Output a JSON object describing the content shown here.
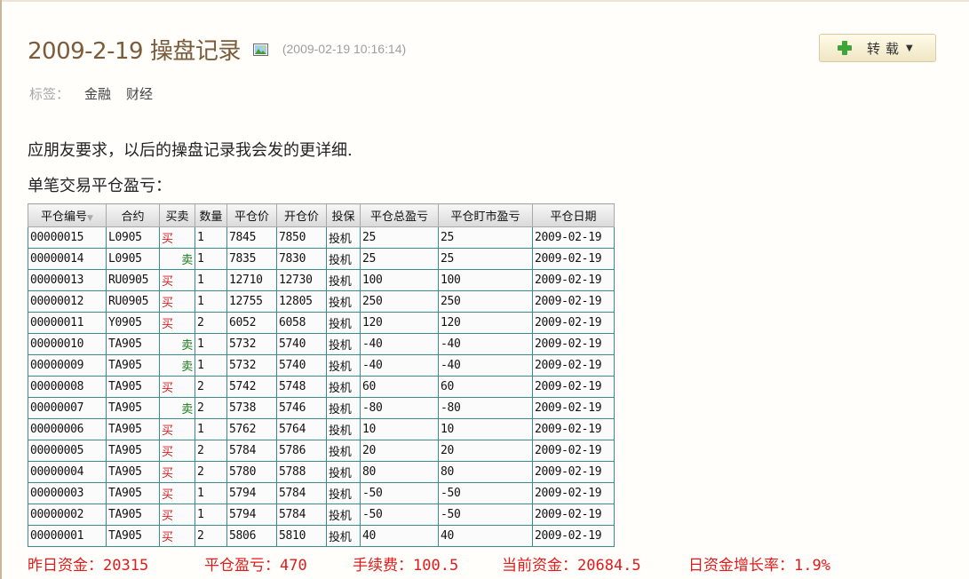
{
  "post": {
    "title": "2009-2-19 操盘记录",
    "time": "(2009-02-19 10:16:14)",
    "repost_label": "转载",
    "tags_label": "标签：",
    "tags": [
      "金融",
      "财经"
    ],
    "para1": "应朋友要求，以后的操盘记录我会发的更详细.",
    "para2": "单笔交易平仓盈亏："
  },
  "table": {
    "headers": [
      "平仓编号",
      "合约",
      "买卖",
      "数量",
      "平仓价",
      "开仓价",
      "投保",
      "平仓总盈亏",
      "平仓盯市盈亏",
      "平仓日期"
    ],
    "rows": [
      [
        "00000015",
        "L0905",
        "买",
        "1",
        "7845",
        "7850",
        "投机",
        "25",
        "25",
        "2009-02-19"
      ],
      [
        "00000014",
        "L0905",
        "卖",
        "1",
        "7835",
        "7830",
        "投机",
        "25",
        "25",
        "2009-02-19"
      ],
      [
        "00000013",
        "RU0905",
        "买",
        "1",
        "12710",
        "12730",
        "投机",
        "100",
        "100",
        "2009-02-19"
      ],
      [
        "00000012",
        "RU0905",
        "买",
        "1",
        "12755",
        "12805",
        "投机",
        "250",
        "250",
        "2009-02-19"
      ],
      [
        "00000011",
        "Y0905",
        "买",
        "2",
        "6052",
        "6058",
        "投机",
        "120",
        "120",
        "2009-02-19"
      ],
      [
        "00000010",
        "TA905",
        "卖",
        "1",
        "5732",
        "5740",
        "投机",
        "-40",
        "-40",
        "2009-02-19"
      ],
      [
        "00000009",
        "TA905",
        "卖",
        "1",
        "5732",
        "5740",
        "投机",
        "-40",
        "-40",
        "2009-02-19"
      ],
      [
        "00000008",
        "TA905",
        "买",
        "2",
        "5742",
        "5748",
        "投机",
        "60",
        "60",
        "2009-02-19"
      ],
      [
        "00000007",
        "TA905",
        "卖",
        "2",
        "5738",
        "5746",
        "投机",
        "-80",
        "-80",
        "2009-02-19"
      ],
      [
        "00000006",
        "TA905",
        "买",
        "1",
        "5762",
        "5764",
        "投机",
        "10",
        "10",
        "2009-02-19"
      ],
      [
        "00000005",
        "TA905",
        "买",
        "2",
        "5784",
        "5786",
        "投机",
        "20",
        "20",
        "2009-02-19"
      ],
      [
        "00000004",
        "TA905",
        "买",
        "2",
        "5780",
        "5788",
        "投机",
        "80",
        "80",
        "2009-02-19"
      ],
      [
        "00000003",
        "TA905",
        "买",
        "1",
        "5794",
        "5784",
        "投机",
        "-50",
        "-50",
        "2009-02-19"
      ],
      [
        "00000002",
        "TA905",
        "买",
        "1",
        "5794",
        "5784",
        "投机",
        "-50",
        "-50",
        "2009-02-19"
      ],
      [
        "00000001",
        "TA905",
        "买",
        "2",
        "5806",
        "5810",
        "投机",
        "40",
        "40",
        "2009-02-19"
      ]
    ]
  },
  "summary": {
    "items": [
      "昨日资金：20315",
      "平仓盈亏：470",
      "手续费：100.5",
      "当前资金：20684.5",
      "日资金增长率：1.9%"
    ]
  },
  "colors": {
    "title": "#7a5c3b",
    "buy": "#d81c1c",
    "sell": "#187a18",
    "summary": "#e01b1b"
  },
  "icons": {
    "title_icon": "image-icon",
    "repost_icon": "plus-icon",
    "repost_caret": "caret-down-icon",
    "sort_indicator": "sort-arrow-icon"
  }
}
